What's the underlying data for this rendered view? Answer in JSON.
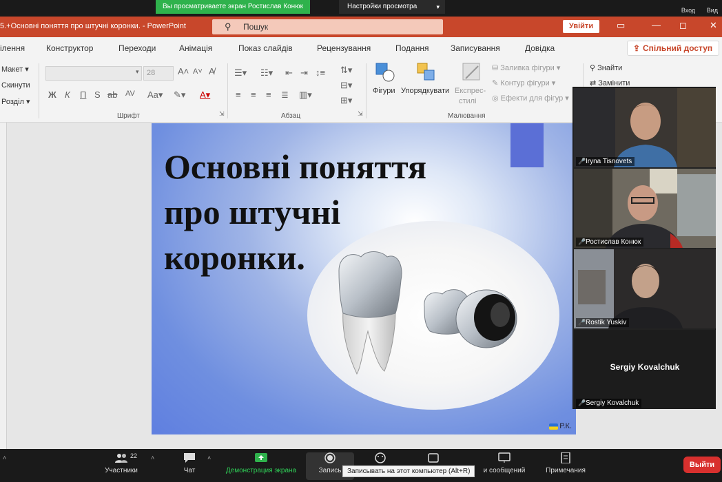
{
  "zoom_top": {
    "share_banner": "Вы просматриваете экран Ростислав Конюк",
    "view_settings": "Настройки просмотра",
    "right_items": [
      "Вход",
      "Вид"
    ]
  },
  "ppt_title": {
    "document": "5.+Основні поняття про штучні коронки.  -  PowerPoint",
    "search_placeholder": "Пошук",
    "sign_in": "Увійти"
  },
  "ribbon_tabs": [
    "ілення",
    "Конструктор",
    "Переходи",
    "Анімація",
    "Показ слайдів",
    "Рецензування",
    "Подання",
    "Записування",
    "Довідка"
  ],
  "share_button": "Спільний доступ",
  "ribbon": {
    "slides_items": [
      "Макет",
      "Скинути",
      "Розділ"
    ],
    "font_size": "28",
    "font_group": "Шрифт",
    "paragraph_group": "Абзац",
    "shapes": "Фігури",
    "arrange": "Упорядкувати",
    "quick_styles": [
      "Експрес-",
      "стилі"
    ],
    "shape_fill": "Заливка фігури",
    "shape_outline": "Контур фігури",
    "shape_effects": "Ефекти для фігур",
    "drawing_group": "Малювання",
    "find": "Знайти",
    "replace": "Замінити"
  },
  "slide": {
    "heading": "Основні поняття про штучні коронки.",
    "corner_label": "Р.К."
  },
  "participants": [
    {
      "name": "Iryna Tisnovets"
    },
    {
      "name": "Ростислав Конюк"
    },
    {
      "name": "Rostik Yuskiv"
    },
    {
      "name": "Sergiy Kovalchuk",
      "display": "Sergiy Kovalchuk"
    }
  ],
  "zoom_toolbar": {
    "participants": "Участники",
    "participants_count": "22",
    "chat": "Чат",
    "share_screen": "Демонстрация экрана",
    "record": "Запись",
    "reactions": "и сообщений",
    "notes": "Примечания",
    "tooltip": "Записывать на этот компьютер (Alt+R)",
    "leave": "Выйти"
  },
  "colors": {
    "ppt_accent": "#c8472b",
    "zoom_green": "#2fb24c",
    "leave_red": "#d8302e"
  }
}
